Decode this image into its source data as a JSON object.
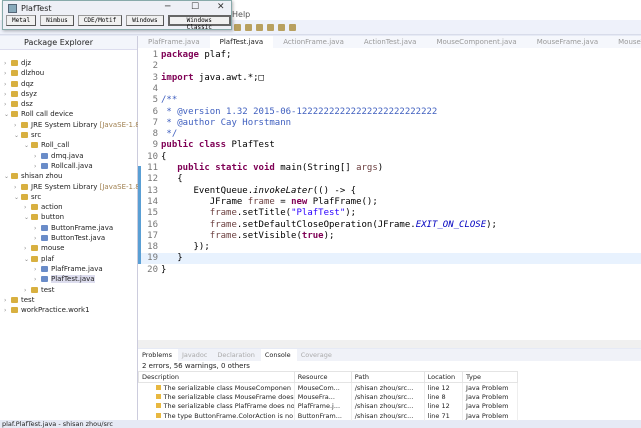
{
  "eclipse": {
    "menu_help": "Help"
  },
  "plaf_window": {
    "title": "PlafTest",
    "buttons": [
      "Metal",
      "Nimbus",
      "CDE/Motif",
      "Windows",
      "Windows Classic"
    ],
    "minimize": "─",
    "maximize": "☐",
    "close": "✕"
  },
  "package_explorer": {
    "title": "Package Explorer",
    "nodes": [
      {
        "label": "djz",
        "depth": 0,
        "open": false
      },
      {
        "label": "dlzhou",
        "depth": 0,
        "open": false
      },
      {
        "label": "dqz",
        "depth": 0,
        "open": false
      },
      {
        "label": "dsyz",
        "depth": 0,
        "open": false
      },
      {
        "label": "dsz",
        "depth": 0,
        "open": false
      },
      {
        "label": "Roll call device",
        "depth": 0,
        "open": true
      },
      {
        "label": "JRE System Library",
        "suffix": "[JavaSE-1.8]",
        "depth": 1,
        "open": false
      },
      {
        "label": "src",
        "depth": 1,
        "open": true
      },
      {
        "label": "Roll_call",
        "depth": 2,
        "open": true
      },
      {
        "label": "dmq.java",
        "depth": 3,
        "open": false
      },
      {
        "label": "Rollcall.java",
        "depth": 3,
        "open": false
      },
      {
        "label": "shisan zhou",
        "depth": 0,
        "open": true
      },
      {
        "label": "JRE System Library",
        "suffix": "[JavaSE-1.8]",
        "depth": 1,
        "open": false
      },
      {
        "label": "src",
        "depth": 1,
        "open": true
      },
      {
        "label": "action",
        "depth": 2,
        "open": false
      },
      {
        "label": "button",
        "depth": 2,
        "open": true
      },
      {
        "label": "ButtonFrame.java",
        "depth": 3,
        "open": false
      },
      {
        "label": "ButtonTest.java",
        "depth": 3,
        "open": false
      },
      {
        "label": "mouse",
        "depth": 2,
        "open": false
      },
      {
        "label": "plaf",
        "depth": 2,
        "open": true
      },
      {
        "label": "PlafFrame.java",
        "depth": 3,
        "open": false
      },
      {
        "label": "PlafTest.java",
        "depth": 3,
        "open": false,
        "selected": true
      },
      {
        "label": "test",
        "depth": 2,
        "open": false
      },
      {
        "label": "test",
        "depth": 0,
        "open": false
      },
      {
        "label": "workPractice.work1",
        "depth": 0,
        "open": false
      }
    ]
  },
  "editor": {
    "tabs": [
      "PlafFrame.java",
      "PlafTest.java",
      "ActionFrame.java",
      "ActionTest.java",
      "MouseComponent.java",
      "MouseFrame.java",
      "MouseTest.java"
    ],
    "active_tab": 1,
    "lines": [
      "<span class=kw>package</span> plaf;",
      "",
      "<span class=kw>import</span> java.awt.*;□",
      "",
      "<span class=cm>/**</span>",
      "<span class=cm> * @version 1.32 2015-06-12222222222222222222222222</span>",
      "<span class=cm> * @author Cay Horstmann</span>",
      "<span class=cm> */</span>",
      "<span class=kw>public class</span> PlafTest",
      "{",
      "   <span class=kw>public static void</span> main(String[] <span class=var>args</span>)",
      "   {",
      "      EventQueue.<i>invokeLater</i>(() -> {",
      "         JFrame <span class=var>frame</span> = <span class=kw>new</span> PlafFrame();",
      "         <span class=var>frame</span>.setTitle(<span class=st>\"PlafTest\"</span>);",
      "         <span class=var>frame</span>.setDefaultCloseOperation(JFrame.<span class=fld>EXIT_ON_CLOSE</span>);",
      "         <span class=var>frame</span>.setVisible(<span class=kw>true</span>);",
      "      });",
      "   }",
      "}"
    ]
  },
  "problems": {
    "tabs": [
      "Problems",
      "Javadoc",
      "Declaration",
      "Console",
      "Coverage"
    ],
    "summary": "2 errors, 56 warnings, 0 others",
    "columns": [
      "Description",
      "Resource",
      "Path",
      "Location",
      "Type"
    ],
    "rows": [
      [
        "The serializable class MouseComponen",
        "MouseCom...",
        "/shisan zhou/src...",
        "line 12",
        "Java Problem"
      ],
      [
        "The serializable class MouseFrame does",
        "MouseFra...",
        "/shisan zhou/src...",
        "line 8",
        "Java Problem"
      ],
      [
        "The serializable class PlafFrame does no",
        "PlafFrame.j...",
        "/shisan zhou/src...",
        "line 12",
        "Java Problem"
      ],
      [
        "The type ButtonFrame.ColorAction is no",
        "ButtonFram...",
        "/shisan zhou/src...",
        "line 71",
        "Java Problem"
      ]
    ]
  },
  "status": "plaf.PlafTest.java - shisan zhou/src"
}
